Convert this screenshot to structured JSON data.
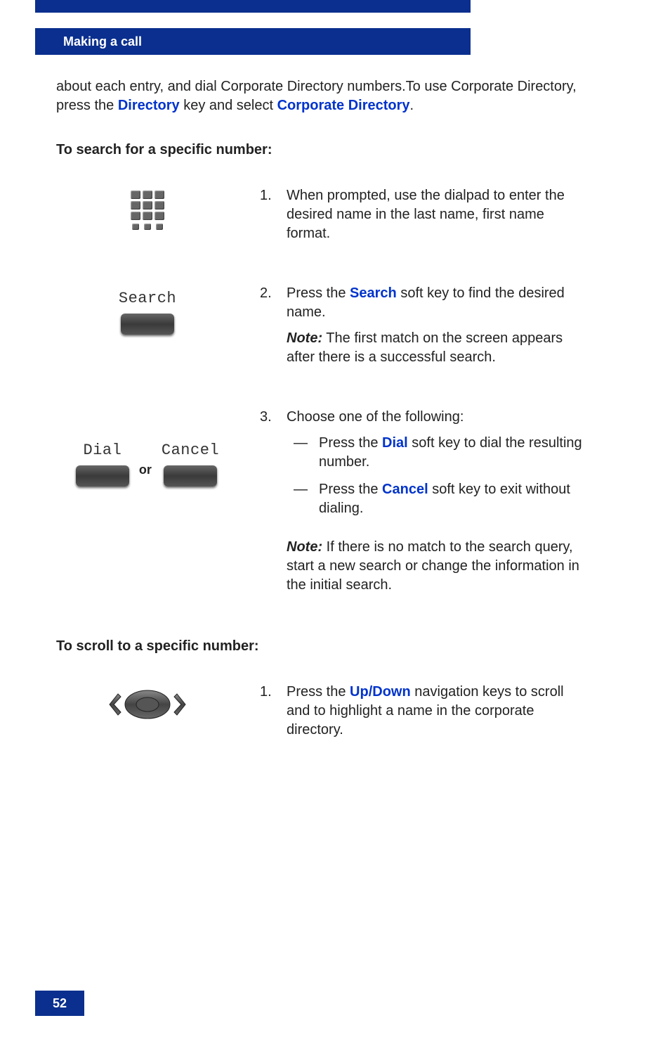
{
  "header": {
    "title": "Making a call"
  },
  "intro": {
    "pre": "about each entry, and dial Corporate Directory numbers.To use Corporate Directory, press the ",
    "hl1": "Directory",
    "mid": " key and select ",
    "hl2": "Corporate Directory",
    "post": "."
  },
  "section1_heading": "To search for a specific number:",
  "step1": {
    "num": "1.",
    "text": "When prompted, use the dialpad to enter the desired name in the last name, first name format."
  },
  "step2": {
    "num": "2.",
    "label": "Search",
    "pre": "Press the ",
    "hl": "Search",
    "post": " soft key to find the desired name.",
    "note_label": "Note:",
    "note_text": " The first match on the screen appears after there is a successful search."
  },
  "step3": {
    "num": "3.",
    "intro": "Choose one of the following:",
    "key1_label": "Dial",
    "key2_label": "Cancel",
    "or": "or",
    "item1_pre": "Press the ",
    "item1_hl": "Dial",
    "item1_post": " soft key to dial the resulting number.",
    "item2_pre": "Press the ",
    "item2_hl": "Cancel",
    "item2_post": " soft key to exit without dialing.",
    "note_label": "Note:",
    "note_text": " If there is no match to the search query, start a new search or change the information in the initial search."
  },
  "section2_heading": "To scroll to a specific number:",
  "step4": {
    "num": "1.",
    "pre": "Press the ",
    "hl": "Up/Down",
    "post": " navigation keys to scroll and to highlight a name in the corporate directory."
  },
  "page_number": "52",
  "dash": "—"
}
